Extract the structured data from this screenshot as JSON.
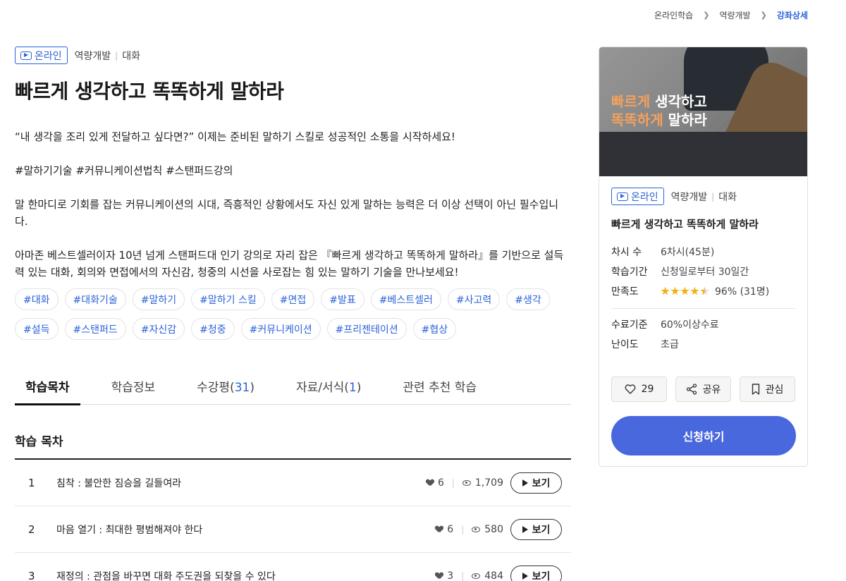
{
  "breadcrumb": {
    "items": [
      "온라인학습",
      "역량개발"
    ],
    "current": "강좌상세"
  },
  "course": {
    "badge": "온라인",
    "category": "역량개발",
    "subcategory": "대화",
    "title": "빠르게 생각하고 똑똑하게 말하라",
    "description": [
      "“내 생각을 조리 있게 전달하고 싶다면?” 이제는 준비된 말하기 스킬로 성공적인 소통을 시작하세요!",
      "#말하기기술 #커뮤니케이션법칙 #스탠퍼드강의",
      "말 한마디로 기회를 잡는 커뮤니케이션의 시대, 즉흥적인 상황에서도 자신 있게 말하는 능력은 더 이상 선택이 아닌 필수입니다.",
      "아마존 베스트셀러이자 10년 넘게 스탠퍼드대 인기 강의로 자리 잡은 『빠르게 생각하고 똑똑하게 말하라』를 기반으로 설득력 있는 대화, 회의와 면접에서의 자신감, 청중의 시선을 사로잡는 힘 있는 말하기 기술을 만나보세요!"
    ],
    "tags": [
      "#대화",
      "#대화기술",
      "#말하기",
      "#말하기 스킬",
      "#면접",
      "#발표",
      "#베스트셀러",
      "#사고력",
      "#생각",
      "#설득",
      "#스탠퍼드",
      "#자신감",
      "#청중",
      "#커뮤니케이션",
      "#프리젠테이션",
      "#협상"
    ]
  },
  "tabs": [
    {
      "label": "학습목차",
      "count": ""
    },
    {
      "label": "학습정보",
      "count": ""
    },
    {
      "label": "수강평(",
      "count": "31",
      "suffix": ")"
    },
    {
      "label": "자료/서식(",
      "count": "1",
      "suffix": ")"
    },
    {
      "label": "관련 추천 학습",
      "count": ""
    }
  ],
  "toc": {
    "title": "학습 목차",
    "view_label": "보기",
    "rows": [
      {
        "num": "1",
        "name": "침착 : 불안한 짐승을 길들여라",
        "likes": "6",
        "views": "1,709"
      },
      {
        "num": "2",
        "name": "마음 열기 : 최대한 평범해져야 한다",
        "likes": "6",
        "views": "580"
      },
      {
        "num": "3",
        "name": "재정의 : 관점을 바꾸면 대화 주도권을 되찾을 수 있다",
        "likes": "3",
        "views": "484"
      }
    ]
  },
  "card": {
    "thumb_title_hl1": "빠르게",
    "thumb_title_rest1": " 생각하고",
    "thumb_title_hl2": "똑똑하게",
    "thumb_title_rest2": " 말하라",
    "badge": "온라인",
    "category": "역량개발",
    "subcategory": "대화",
    "title": "빠르게 생각하고 똑똑하게 말하라",
    "info": {
      "sessions_label": "차시 수",
      "sessions": "6차시(45분)",
      "period_label": "학습기간",
      "period": "신청일로부터 30일간",
      "rating_label": "만족도",
      "rating": "96% (31명)",
      "rating_stars": 4.5,
      "complete_label": "수료기준",
      "complete": "60%이상수료",
      "level_label": "난이도",
      "level": "초급"
    },
    "like_count": "29",
    "share_label": "공유",
    "bookmark_label": "관심",
    "apply_label": "신청하기"
  },
  "colors": {
    "accent": "#2b63d9",
    "apply_button": "#4a68de",
    "star": "#f2b015"
  }
}
